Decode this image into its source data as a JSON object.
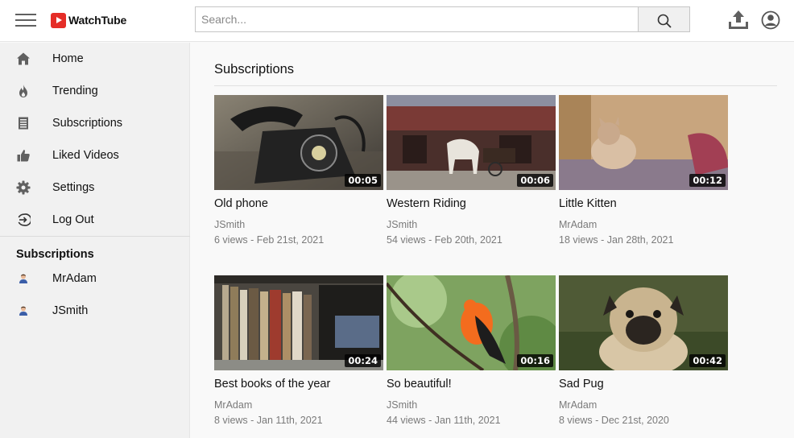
{
  "app": {
    "name": "WatchTube",
    "brand_color": "#e52d27"
  },
  "header": {
    "search_placeholder": "Search...",
    "search_value": "",
    "icons": [
      "hamburger-menu-icon",
      "search-icon",
      "upload-icon",
      "account-circle-icon"
    ]
  },
  "sidebar": {
    "items": [
      {
        "label": "Home",
        "icon": "home-icon"
      },
      {
        "label": "Trending",
        "icon": "flame-icon"
      },
      {
        "label": "Subscriptions",
        "icon": "subscriptions-icon"
      },
      {
        "label": "Liked Videos",
        "icon": "thumbs-up-icon"
      },
      {
        "label": "Settings",
        "icon": "gear-icon"
      },
      {
        "label": "Log Out",
        "icon": "logout-icon"
      }
    ],
    "subscriptions_heading": "Subscriptions",
    "subscriptions": [
      {
        "name": "MrAdam",
        "icon": "user-avatar-icon"
      },
      {
        "name": "JSmith",
        "icon": "user-avatar-icon"
      }
    ]
  },
  "main": {
    "title": "Subscriptions",
    "videos": [
      {
        "title": "Old phone",
        "channel": "JSmith",
        "meta": "6 views - Feb 21st, 2021",
        "duration": "00:05"
      },
      {
        "title": "Western Riding",
        "channel": "JSmith",
        "meta": "54 views - Feb 20th, 2021",
        "duration": "00:06"
      },
      {
        "title": "Little Kitten",
        "channel": "MrAdam",
        "meta": "18 views - Jan 28th, 2021",
        "duration": "00:12"
      },
      {
        "title": "Best books of the year",
        "channel": "MrAdam",
        "meta": "8 views - Jan 11th, 2021",
        "duration": "00:24"
      },
      {
        "title": "So beautiful!",
        "channel": "JSmith",
        "meta": "44 views - Jan 11th, 2021",
        "duration": "00:16"
      },
      {
        "title": "Sad Pug",
        "channel": "MrAdam",
        "meta": "8 views - Dec 21st, 2020",
        "duration": "00:42"
      }
    ]
  }
}
